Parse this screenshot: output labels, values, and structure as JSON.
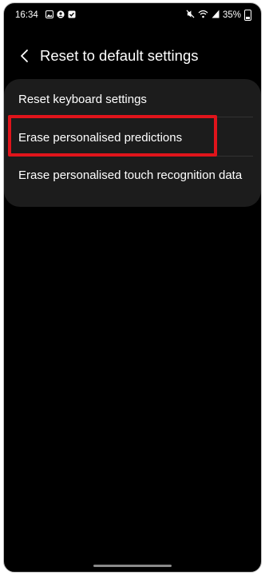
{
  "status": {
    "time": "16:34",
    "battery": "35%"
  },
  "header": {
    "title": "Reset to default settings"
  },
  "items": [
    {
      "label": "Reset keyboard settings"
    },
    {
      "label": "Erase personalised predictions"
    },
    {
      "label": "Erase personalised touch recognition data"
    }
  ],
  "colors": {
    "background": "#000000",
    "card": "#1c1c1c",
    "highlight": "#e0141b",
    "text": "#ffffff"
  }
}
